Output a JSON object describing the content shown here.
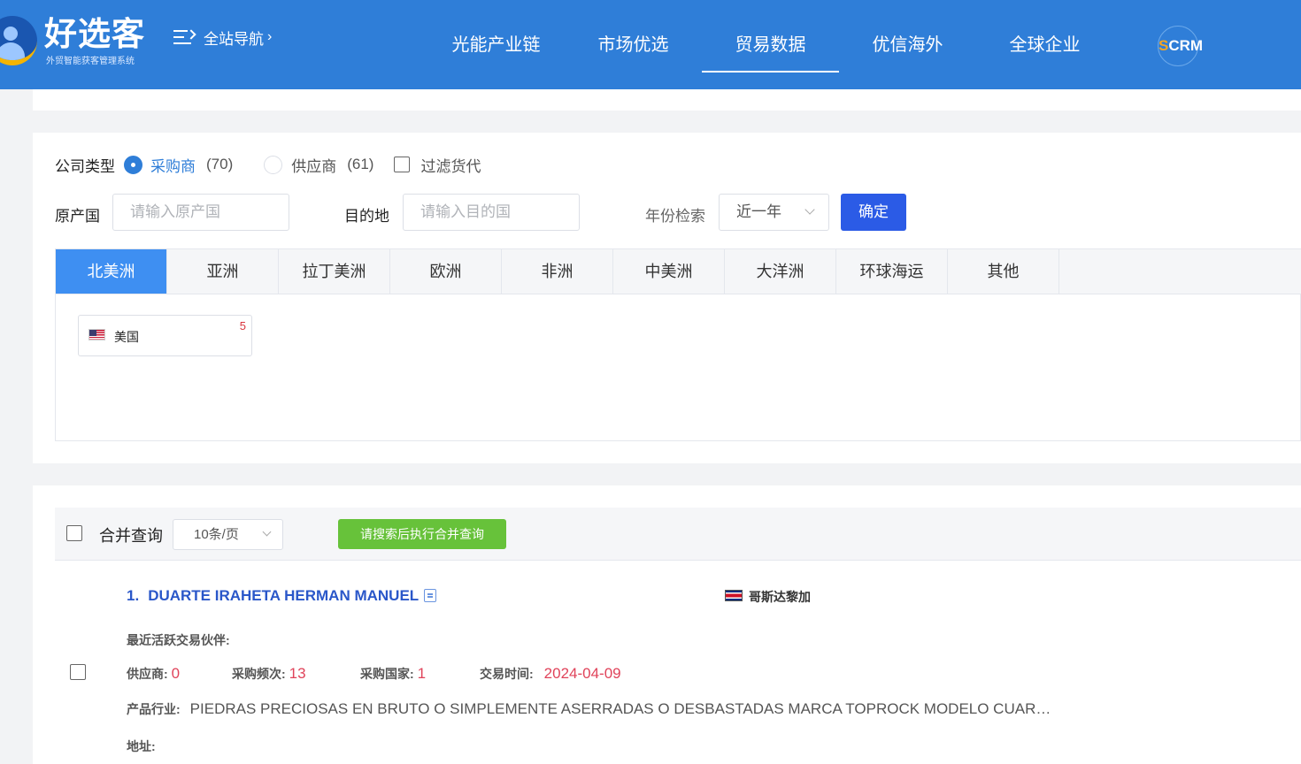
{
  "header": {
    "logo_title": "好选客",
    "logo_subtitle": "外贸智能获客管理系统",
    "site_nav_label": "全站导航",
    "nav": [
      "光能产业链",
      "市场优选",
      "贸易数据",
      "优信海外",
      "全球企业"
    ],
    "active_nav": "贸易数据",
    "scrm_s": "S",
    "scrm_rest": "CRM"
  },
  "filters": {
    "company_type_label": "公司类型",
    "buyer_label": "采购商",
    "buyer_count": "(70)",
    "supplier_label": "供应商",
    "supplier_count": "(61)",
    "filter_forwarder_label": "过滤货代",
    "origin_label": "原产国",
    "origin_placeholder": "请输入原产国",
    "destination_label": "目的地",
    "destination_placeholder": "请输入目的国",
    "year_label": "年份检索",
    "year_value": "近一年",
    "confirm_label": "确定"
  },
  "regions": {
    "tabs": [
      "北美洲",
      "亚洲",
      "拉丁美洲",
      "欧洲",
      "非洲",
      "中美洲",
      "大洋洲",
      "环球海运",
      "其他"
    ],
    "active_tab": "北美洲",
    "countries": [
      {
        "name": "美国",
        "count": "5"
      }
    ]
  },
  "results_toolbar": {
    "merge_label": "合并查询",
    "page_size": "10条/页",
    "merge_button": "请搜索后执行合并查询"
  },
  "results": [
    {
      "index": "1.",
      "name": "DUARTE IRAHETA HERMAN MANUEL",
      "country": "哥斯达黎加",
      "partner_label": "最近活跃交易伙伴:",
      "supplier_label": "供应商:",
      "supplier_value": "0",
      "frequency_label": "采购频次:",
      "frequency_value": "13",
      "countries_label": "采购国家:",
      "countries_value": "1",
      "date_label": "交易时间:",
      "date_value": "2024-04-09",
      "industry_label": "产品行业:",
      "industry_value": "PIEDRAS PRECIOSAS EN BRUTO O SIMPLEMENTE ASERRADAS O DESBASTADAS MARCA TOPROCK MODELO CUAR…",
      "address_label": "地址:"
    }
  ],
  "colors": {
    "header_bg": "#2f7ed8",
    "active_tab_bg": "#3e8ff2",
    "confirm_btn": "#2b5be6",
    "merge_btn": "#67c23a",
    "stat_value": "#e0435a",
    "title_link": "#2a57c9"
  }
}
